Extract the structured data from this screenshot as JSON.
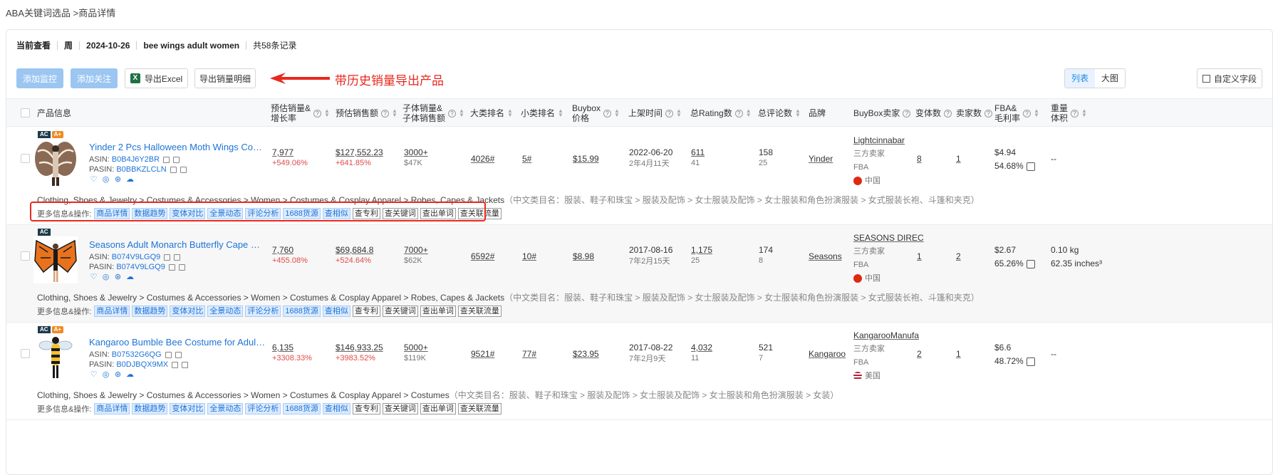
{
  "breadcrumb": {
    "root": "ABA关键词选品",
    "sep": ">",
    "current": "商品详情"
  },
  "infobar": {
    "label": "当前查看",
    "period": "周",
    "date": "2024-10-26",
    "keyword": "bee wings adult women",
    "records": "共58条记录"
  },
  "toolbar": {
    "add_monitor": "添加监控",
    "add_follow": "添加关注",
    "export_excel": "导出Excel",
    "export_sales": "导出销量明细",
    "annotation": "带历史销量导出产品",
    "view_list": "列表",
    "view_large": "大图",
    "custom_fields": "自定义字段"
  },
  "columns": {
    "product": "产品信息",
    "est_sales_1": "预估销量&",
    "est_sales_2": "增长率",
    "est_revenue": "预估销售额",
    "child_sales_1": "子体销量&",
    "child_sales_2": "子体销售额",
    "main_rank": "大类排名",
    "sub_rank": "小类排名",
    "buybox_1": "Buybox",
    "buybox_2": "价格",
    "listed": "上架时间",
    "rating_count": "总Rating数",
    "review_count": "总评论数",
    "brand": "品牌",
    "buybox_seller": "BuyBox卖家",
    "variants": "变体数",
    "sellers": "卖家数",
    "fba_1": "FBA&",
    "fba_2": "毛利率",
    "weight_1": "重量",
    "weight_2": "体积"
  },
  "actions_label": "更多信息&操作:",
  "actions_blue": [
    "商品详情",
    "数据趋势",
    "变体对比",
    "全景动态",
    "评论分析",
    "1688货源",
    "查相似"
  ],
  "actions_white": [
    "查专利",
    "查关键词",
    "查出单词",
    "查关联流量"
  ],
  "rows": [
    {
      "badges": [
        "AC",
        "A+"
      ],
      "title": "Yinder 2 Pcs Halloween Moth Wings Costume...",
      "asin_label": "ASIN:",
      "asin": "B0B4J6Y2BR",
      "pasin_label": "PASIN:",
      "pasin": "B0BBKZLCLN",
      "sales": "7,977",
      "sales_growth": "+549.06%",
      "revenue": "$127,552.23",
      "revenue_growth": "+641.85%",
      "child_sales": "3000+",
      "child_revenue": "$47K",
      "main_rank": "4026#",
      "sub_rank": "5#",
      "price": "$15.99",
      "listed": "2022-06-20",
      "listed_age": "2年4月11天",
      "rating": "611",
      "rating_sub": "41",
      "reviews": "158",
      "reviews_sub": "25",
      "brand": "Yinder",
      "seller": "Lightcinnabar",
      "seller_type": "三方卖家",
      "fulfil": "FBA",
      "country": "中国",
      "variants": "8",
      "sellers": "1",
      "fba_fee": "$4.94",
      "margin": "54.68%",
      "weight": "--",
      "volume": "",
      "category": "Clothing, Shoes & Jewelry > Costumes & Accessories > Women > Costumes & Cosplay Apparel > Robes, Capes & Jackets",
      "category_cn": "（中文类目名：服装、鞋子和珠宝 > 服装及配饰 > 女士服装及配饰 > 女士服装和角色扮演服装 > 女式服装长袍、斗篷和夹克）"
    },
    {
      "badges": [
        "AC"
      ],
      "title": "Seasons Adult Monarch Butterfly Cape Wings...",
      "asin_label": "ASIN:",
      "asin": "B074V9LGQ9",
      "pasin_label": "PASIN:",
      "pasin": "B074V9LGQ9",
      "sales": "7,760",
      "sales_growth": "+455.08%",
      "revenue": "$69,684.8",
      "revenue_growth": "+524.64%",
      "child_sales": "7000+",
      "child_revenue": "$62K",
      "main_rank": "6592#",
      "sub_rank": "10#",
      "price": "$8.98",
      "listed": "2017-08-16",
      "listed_age": "7年2月15天",
      "rating": "1,175",
      "rating_sub": "25",
      "reviews": "174",
      "reviews_sub": "8",
      "brand": "Seasons",
      "seller": "SEASONS DIREC",
      "seller_type": "三方卖家",
      "fulfil": "FBA",
      "country": "中国",
      "variants": "1",
      "sellers": "2",
      "fba_fee": "$2.67",
      "margin": "65.26%",
      "weight": "0.10 kg",
      "volume": "62.35 inches³",
      "category": "Clothing, Shoes & Jewelry > Costumes & Accessories > Women > Costumes & Cosplay Apparel > Robes, Capes & Jackets",
      "category_cn": "（中文类目名：服装、鞋子和珠宝 > 服装及配饰 > 女士服装及配饰 > 女士服装和角色扮演服装 > 女式服装长袍、斗篷和夹克）"
    },
    {
      "badges": [
        "AC",
        "A+"
      ],
      "title": "Kangaroo Bumble Bee Costume for Adults &...",
      "asin_label": "ASIN:",
      "asin": "B07532G6QG",
      "pasin_label": "PASIN:",
      "pasin": "B0DJBQX9MX",
      "sales": "6,135",
      "sales_growth": "+3308.33%",
      "revenue": "$146,933.25",
      "revenue_growth": "+3983.52%",
      "child_sales": "5000+",
      "child_revenue": "$119K",
      "main_rank": "9521#",
      "sub_rank": "77#",
      "price": "$23.95",
      "listed": "2017-08-22",
      "listed_age": "7年2月9天",
      "rating": "4,032",
      "rating_sub": "11",
      "reviews": "521",
      "reviews_sub": "7",
      "brand": "Kangaroo",
      "seller": "KangarooManufa",
      "seller_type": "三方卖家",
      "fulfil": "FBA",
      "country": "美国",
      "variants": "2",
      "sellers": "1",
      "fba_fee": "$6.6",
      "margin": "48.72%",
      "weight": "--",
      "volume": "",
      "category": "Clothing, Shoes & Jewelry > Costumes & Accessories > Women > Costumes & Cosplay Apparel > Costumes",
      "category_cn": "（中文类目名：服装、鞋子和珠宝 > 服装及配饰 > 女士服装及配饰 > 女士服装和角色扮演服装 > 女装）"
    }
  ]
}
